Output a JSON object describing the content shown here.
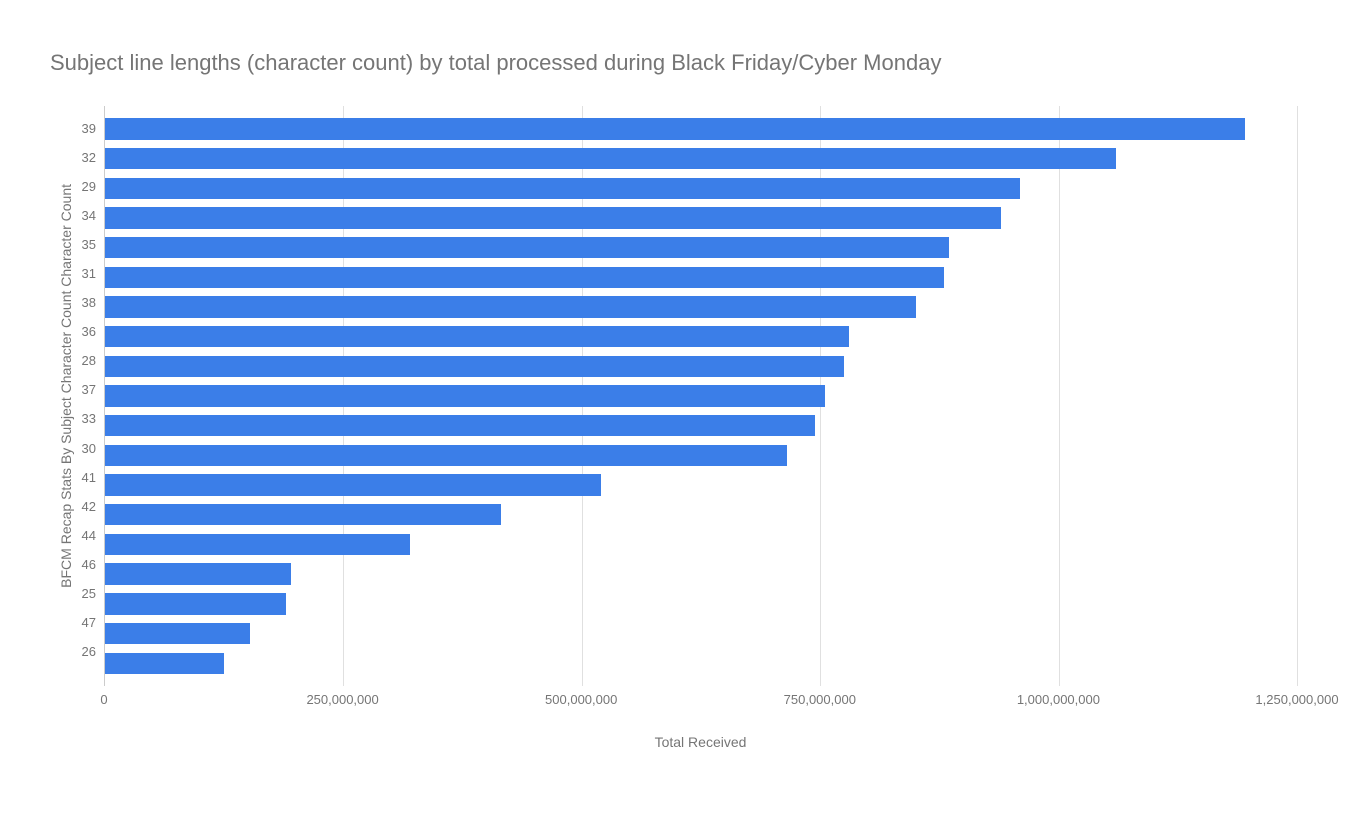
{
  "chart_data": {
    "type": "bar",
    "orientation": "horizontal",
    "title": "Subject line lengths (character count) by total processed during Black Friday/Cyber Monday",
    "xlabel": "Total Received",
    "ylabel": "BFCM Recap Stats By Subject Character Count Character Count",
    "categories": [
      "39",
      "32",
      "29",
      "34",
      "35",
      "31",
      "38",
      "36",
      "28",
      "37",
      "33",
      "30",
      "41",
      "42",
      "44",
      "46",
      "25",
      "47",
      "26"
    ],
    "values": [
      1195000000,
      1060000000,
      960000000,
      940000000,
      885000000,
      880000000,
      850000000,
      780000000,
      775000000,
      755000000,
      745000000,
      715000000,
      520000000,
      415000000,
      320000000,
      195000000,
      190000000,
      152000000,
      125000000
    ],
    "xlim": [
      0,
      1250000000
    ],
    "x_ticks": [
      0,
      250000000,
      500000000,
      750000000,
      1000000000,
      1250000000
    ],
    "x_tick_labels": [
      "0",
      "250,000,000",
      "500,000,000",
      "750,000,000",
      "1,000,000,000",
      "1,250,000,000"
    ],
    "bar_color": "#3b7ee8"
  }
}
